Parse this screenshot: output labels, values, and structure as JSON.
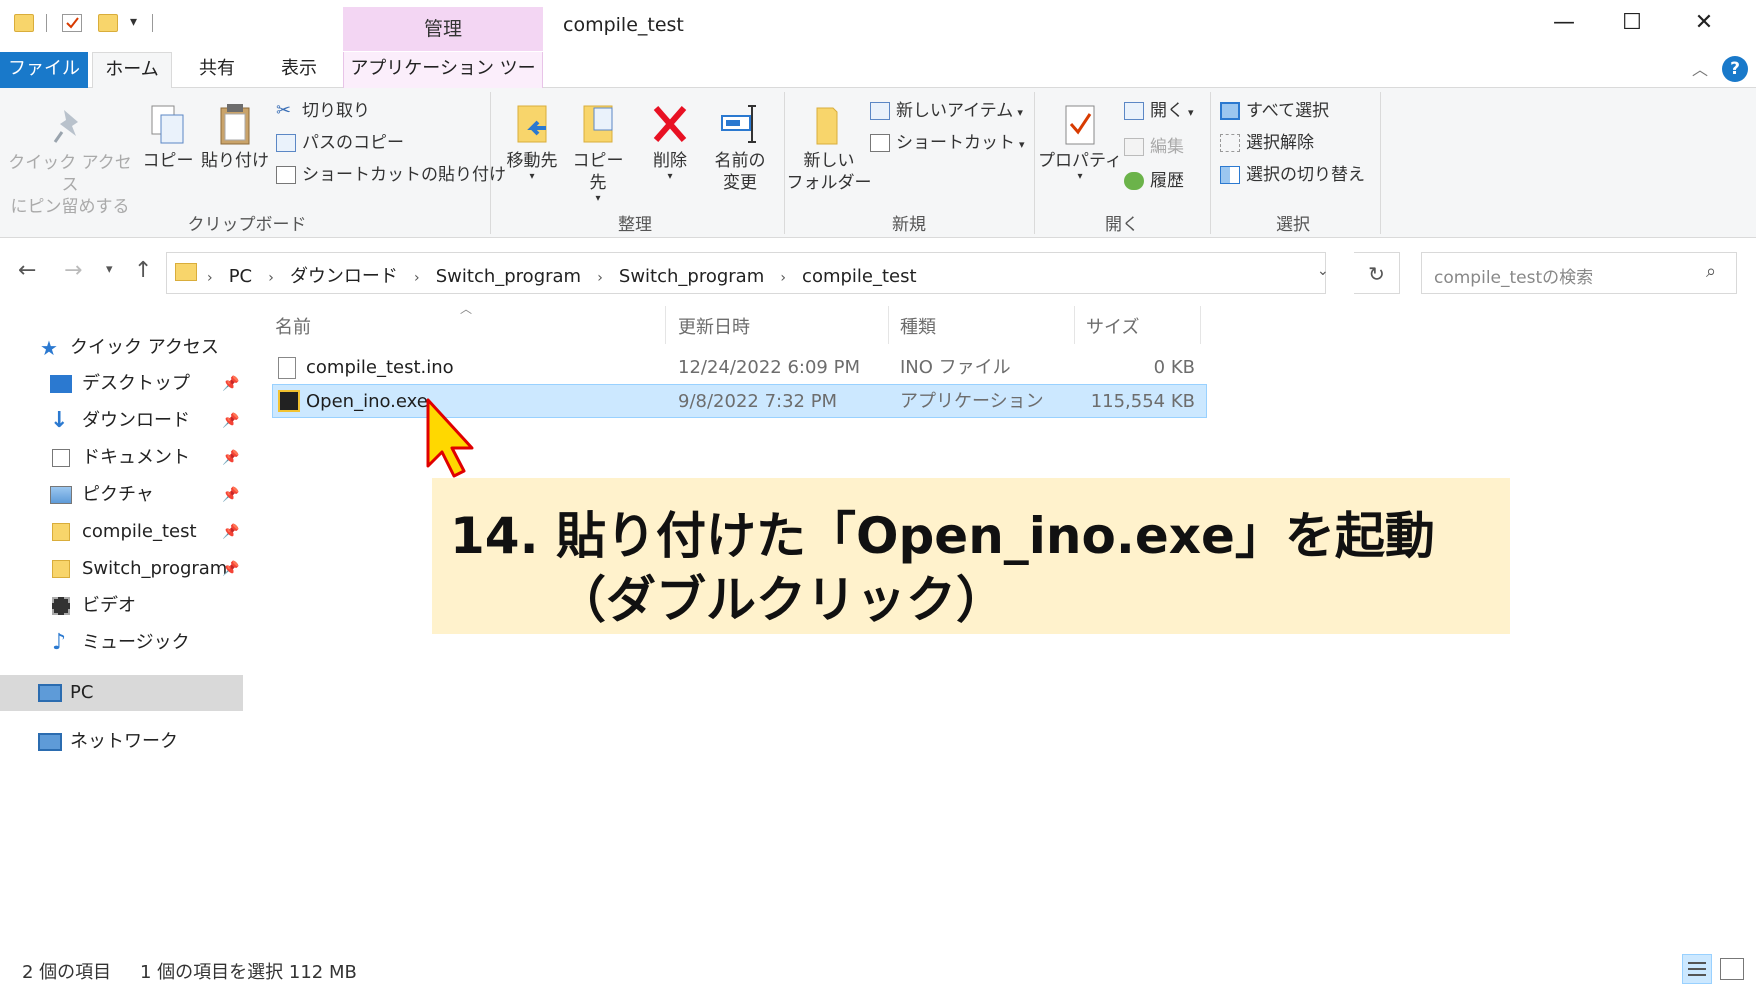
{
  "window": {
    "title": "compile_test",
    "context_tab": "管理",
    "minimize": "—",
    "maximize": "☐",
    "close": "✕"
  },
  "tabs": {
    "file": "ファイル",
    "home": "ホーム",
    "share": "共有",
    "view": "表示",
    "app_tools": "アプリケーション ツール"
  },
  "ribbon": {
    "clipboard": {
      "label": "クリップボード",
      "pin_quick_access_1": "クイック アクセス",
      "pin_quick_access_2": "にピン留めする",
      "copy": "コピー",
      "paste": "貼り付け",
      "cut": "切り取り",
      "copy_path": "パスのコピー",
      "paste_shortcut": "ショートカットの貼り付け"
    },
    "organize": {
      "label": "整理",
      "move_to": "移動先",
      "copy_to": "コピー先",
      "delete": "削除",
      "rename_1": "名前の",
      "rename_2": "変更"
    },
    "new": {
      "label": "新規",
      "new_folder_1": "新しい",
      "new_folder_2": "フォルダー",
      "new_item": "新しいアイテム",
      "shortcut": "ショートカット"
    },
    "open": {
      "label": "開く",
      "properties": "プロパティ",
      "open": "開く",
      "edit": "編集",
      "history": "履歴"
    },
    "select": {
      "label": "選択",
      "select_all": "すべて選択",
      "select_none": "選択解除",
      "invert": "選択の切り替え"
    }
  },
  "address": {
    "crumbs": [
      "PC",
      "ダウンロード",
      "Switch_program",
      "Switch_program",
      "compile_test"
    ],
    "search_placeholder": "compile_testの検索"
  },
  "navpane": {
    "quick_access": "クイック アクセス",
    "items": [
      "デスクトップ",
      "ダウンロード",
      "ドキュメント",
      "ピクチャ",
      "compile_test",
      "Switch_program",
      "ビデオ",
      "ミュージック"
    ],
    "pc": "PC",
    "network": "ネットワーク"
  },
  "columns": {
    "name": "名前",
    "modified": "更新日時",
    "type": "種類",
    "size": "サイズ"
  },
  "files": [
    {
      "name": "compile_test.ino",
      "modified": "12/24/2022 6:09 PM",
      "type": "INO ファイル",
      "size": "0 KB"
    },
    {
      "name": "Open_ino.exe",
      "modified": "9/8/2022 7:32 PM",
      "type": "アプリケーション",
      "size": "115,554 KB"
    }
  ],
  "annotation": {
    "line1": "14. 貼り付けた「Open_ino.exe」を起動",
    "line2": "（ダブルクリック）"
  },
  "status": {
    "count": "2 個の項目",
    "selection": "1 個の項目を選択  112 MB"
  },
  "colors": {
    "accent": "#1979ca",
    "selection": "#cce8ff",
    "annotation_bg": "#fff2cc",
    "cursor": "#ffd800"
  }
}
